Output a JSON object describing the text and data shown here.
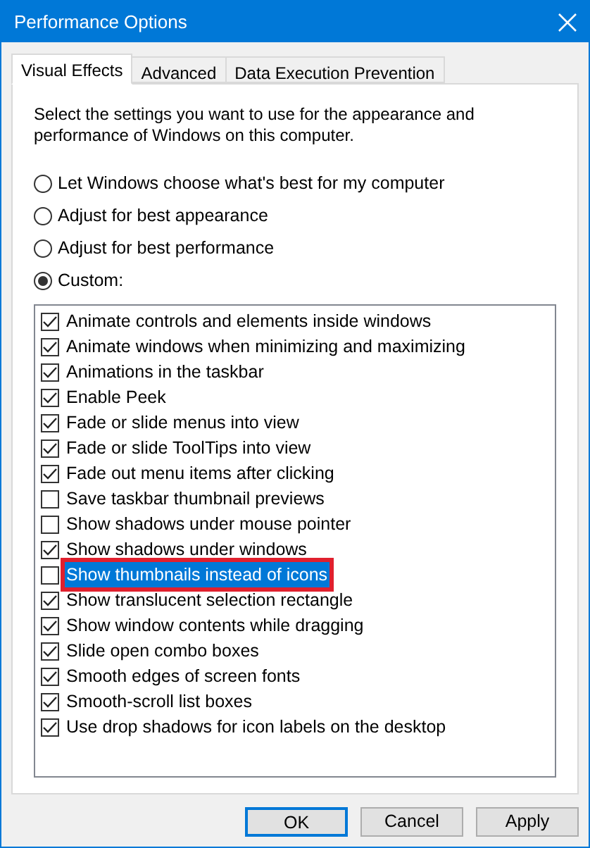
{
  "window": {
    "title": "Performance Options"
  },
  "tabs": [
    {
      "label": "Visual Effects",
      "selected": true
    },
    {
      "label": "Advanced",
      "selected": false
    },
    {
      "label": "Data Execution Prevention",
      "selected": false
    }
  ],
  "description": "Select the settings you want to use for the appearance and performance of Windows on this computer.",
  "options": [
    {
      "label": "Let Windows choose what's best for my computer",
      "selected": false
    },
    {
      "label": "Adjust for best appearance",
      "selected": false
    },
    {
      "label": "Adjust for best performance",
      "selected": false
    },
    {
      "label": "Custom:",
      "selected": true
    }
  ],
  "effects": [
    {
      "label": "Animate controls and elements inside windows",
      "checked": true,
      "selected": false,
      "highlighted": false
    },
    {
      "label": "Animate windows when minimizing and maximizing",
      "checked": true,
      "selected": false,
      "highlighted": false
    },
    {
      "label": "Animations in the taskbar",
      "checked": true,
      "selected": false,
      "highlighted": false
    },
    {
      "label": "Enable Peek",
      "checked": true,
      "selected": false,
      "highlighted": false
    },
    {
      "label": "Fade or slide menus into view",
      "checked": true,
      "selected": false,
      "highlighted": false
    },
    {
      "label": "Fade or slide ToolTips into view",
      "checked": true,
      "selected": false,
      "highlighted": false
    },
    {
      "label": "Fade out menu items after clicking",
      "checked": true,
      "selected": false,
      "highlighted": false
    },
    {
      "label": "Save taskbar thumbnail previews",
      "checked": false,
      "selected": false,
      "highlighted": false
    },
    {
      "label": "Show shadows under mouse pointer",
      "checked": false,
      "selected": false,
      "highlighted": false
    },
    {
      "label": "Show shadows under windows",
      "checked": true,
      "selected": false,
      "highlighted": false
    },
    {
      "label": "Show thumbnails instead of icons",
      "checked": false,
      "selected": true,
      "highlighted": true
    },
    {
      "label": "Show translucent selection rectangle",
      "checked": true,
      "selected": false,
      "highlighted": false
    },
    {
      "label": "Show window contents while dragging",
      "checked": true,
      "selected": false,
      "highlighted": false
    },
    {
      "label": "Slide open combo boxes",
      "checked": true,
      "selected": false,
      "highlighted": false
    },
    {
      "label": "Smooth edges of screen fonts",
      "checked": true,
      "selected": false,
      "highlighted": false
    },
    {
      "label": "Smooth-scroll list boxes",
      "checked": true,
      "selected": false,
      "highlighted": false
    },
    {
      "label": "Use drop shadows for icon labels on the desktop",
      "checked": true,
      "selected": false,
      "highlighted": false
    }
  ],
  "buttons": [
    {
      "label": "OK",
      "default": true
    },
    {
      "label": "Cancel",
      "default": false
    },
    {
      "label": "Apply",
      "default": false
    }
  ]
}
